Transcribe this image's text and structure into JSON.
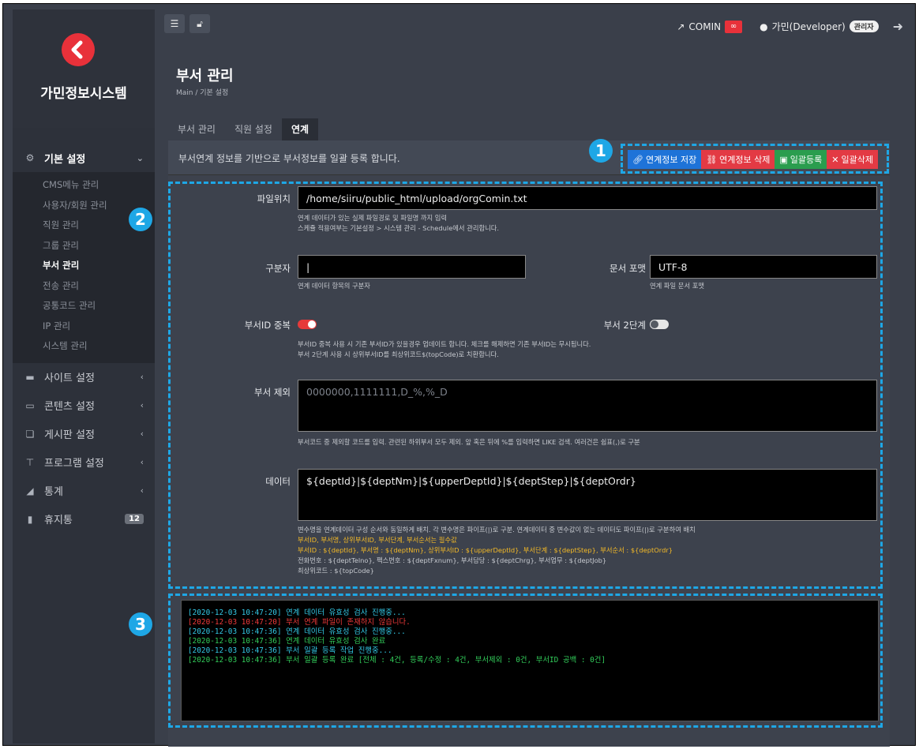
{
  "sidebar": {
    "site_title": "가민정보시스템",
    "menus": [
      {
        "label": "기본 설정",
        "icon": "gears-icon",
        "expanded": true
      },
      {
        "label": "사이트 설정",
        "icon": "monitor-icon"
      },
      {
        "label": "콘텐츠 설정",
        "icon": "content-icon"
      },
      {
        "label": "게시판 설정",
        "icon": "chat-icon"
      },
      {
        "label": "프로그램 설정",
        "icon": "sitemap-icon"
      },
      {
        "label": "통계",
        "icon": "chart-icon"
      },
      {
        "label": "휴지통",
        "icon": "trash-icon",
        "badge": "12"
      }
    ],
    "submenu": [
      "CMS메뉴 관리",
      "사용자/회원 관리",
      "직원 관리",
      "그룹 관리",
      "부서 관리",
      "전송 관리",
      "공통코드 관리",
      "IP 관리",
      "시스템 관리"
    ],
    "active_sub": "부서 관리"
  },
  "topbar": {
    "comin": "COMIN",
    "user": "가민(Developer)",
    "role": "관리자"
  },
  "page": {
    "title": "부서 관리",
    "breadcrumb": "Main  /  기본 설정"
  },
  "tabs": [
    "부서 관리",
    "직원 설정",
    "연계"
  ],
  "active_tab": "연계",
  "notice": "부서연계 정보를 기반으로 부서정보를 일괄 등록 합니다.",
  "actions": {
    "save": "연계정보 저장",
    "delete": "연계정보 삭제",
    "bulk_register": "일괄등록",
    "bulk_delete": "일괄삭제"
  },
  "markers": [
    "1",
    "2",
    "3"
  ],
  "form": {
    "file_label": "파일위치",
    "file_value": "/home/siiru/public_html/upload/orgComin.txt",
    "file_help1": "연계 데이터가 있는 실제 파일경로 및 파일명 까지 입력",
    "file_help2": "스케쥴 적용여부는 기본설정 > 시스템 관리 - Schedule에서 관리합니다.",
    "delim_label": "구분자",
    "delim_value": "|",
    "delim_help": "연계 데이터 항목의 구분자",
    "encoding_label": "문서 포맷",
    "encoding_value": "UTF-8",
    "encoding_help": "연계 파일 문서 포맷",
    "dup_label": "부서ID 중복",
    "dup_on": true,
    "step_label": "부서 2단계",
    "step_on": false,
    "dup_help1": "부서ID 중복 사용 시 기존 부서ID가 있을경우 업데이트 합니다. 체크를 해제하면 기존 부서ID는 무시됩니다.",
    "dup_help2": "부서 2단계 사용 시 상위부서ID를 최상위코드$(topCode)로 치환합니다.",
    "exclude_label": "부서 제외",
    "exclude_placeholder": "0000000,1111111,D_%,%_D",
    "exclude_help": "부서코드 중 제외할 코드를 입력. 관련된 하위부서 모두 제외. 앞 혹은 뒤에 %를 입력하면 LIKE 검색. 여러건은 쉼표(,)로 구분",
    "data_label": "데이터",
    "data_value": "${deptId}|${deptNm}|${upperDeptId}|${deptStep}|${deptOrdr}",
    "data_help1": "변수명을 연계데이터 구성 순서와 동일하게 배치. 각 변수명은 파이프(|)로 구분. 연계데이터 중 변수값이 없는 데이터도 파이프(|)로 구분하여 배치",
    "data_help2": "부서ID, 부서명, 상위부서ID, 부서단계, 부서순서는 필수값",
    "data_help3": "부서ID : ${deptId}, 부서명 : ${deptNm}, 상위부서ID : ${upperDeptId}, 부서단계 : ${deptStep}, 부서순서 : ${deptOrdr}",
    "data_help4": "전화번호 : ${deptTelno}, 팩스번호 : ${deptFxnum}, 부서담당 : ${deptChrg}, 부서업무 : ${deptJob}",
    "data_help5": "최상위코드 : ${topCode}"
  },
  "log": [
    {
      "text": "[2020-12-03 10:47:20] 연계 데이터 유효성 검사 진행중...",
      "color": "#33c9e6"
    },
    {
      "text": "[2020-12-03 10:47:20] 부서 연계 파일이 존재하지 않습니다.",
      "color": "#ef3a3a"
    },
    {
      "text": "[2020-12-03 10:47:36] 연계 데이터 유효성 검사 진행중...",
      "color": "#33c9e6"
    },
    {
      "text": "[2020-12-03 10:47:36] 연계 데이터 유효성 검사 완료",
      "color": "#32cd5a"
    },
    {
      "text": "[2020-12-03 10:47:36] 부서 일괄 등록 작업 진행중...",
      "color": "#33c9e6"
    },
    {
      "text": "[2020-12-03 10:47:36] 부서 일괄 등록 완료 [전체 : 4건, 등록/수정 : 4건, 부서제외 : 0건, 부서ID 공백 : 0건]",
      "color": "#32cd5a"
    }
  ],
  "colors": {
    "accent": "#1ea7e6",
    "brand_red": "#e8313a",
    "save_blue": "#1e73d8",
    "register_green": "#2a9d4e"
  }
}
